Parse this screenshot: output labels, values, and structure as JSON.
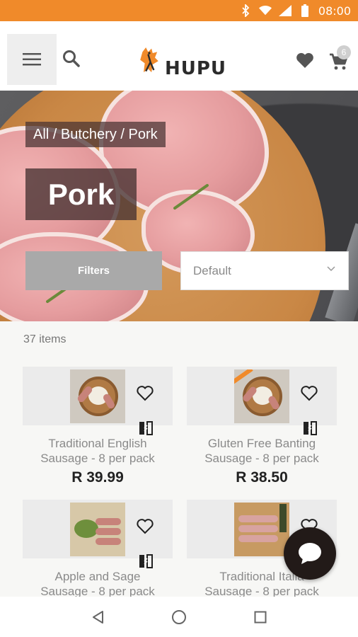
{
  "status_bar": {
    "time": "08:00",
    "icons": [
      "bluetooth-icon",
      "wifi-icon",
      "lte-signal-icon",
      "battery-icon"
    ]
  },
  "header": {
    "logo_text": "HUPU",
    "cart_count": "6",
    "icons": [
      "menu-icon",
      "search-icon",
      "heart-icon",
      "cart-icon"
    ]
  },
  "hero": {
    "breadcrumb": "All / Butchery / Pork",
    "title": "Pork",
    "filters_label": "Filters",
    "sort_value": "Default"
  },
  "listing": {
    "count_text": "37 items",
    "products": [
      {
        "name_line1": "Traditional English",
        "name_line2": "Sausage - 8 per pack",
        "price": "R 39.99"
      },
      {
        "name_line1": "Gluten Free Banting",
        "name_line2": "Sausage - 8 per pack",
        "price": "R 38.50"
      },
      {
        "name_line1": "Apple and Sage",
        "name_line2": "Sausage - 8 per pack",
        "price": ""
      },
      {
        "name_line1": "Traditional Italia",
        "name_line2": "Sausage - 8 per pack",
        "price": ""
      }
    ]
  },
  "colors": {
    "accent": "#f08a2a",
    "dark": "#221a18",
    "filters_bg": "#a9a9a9"
  }
}
